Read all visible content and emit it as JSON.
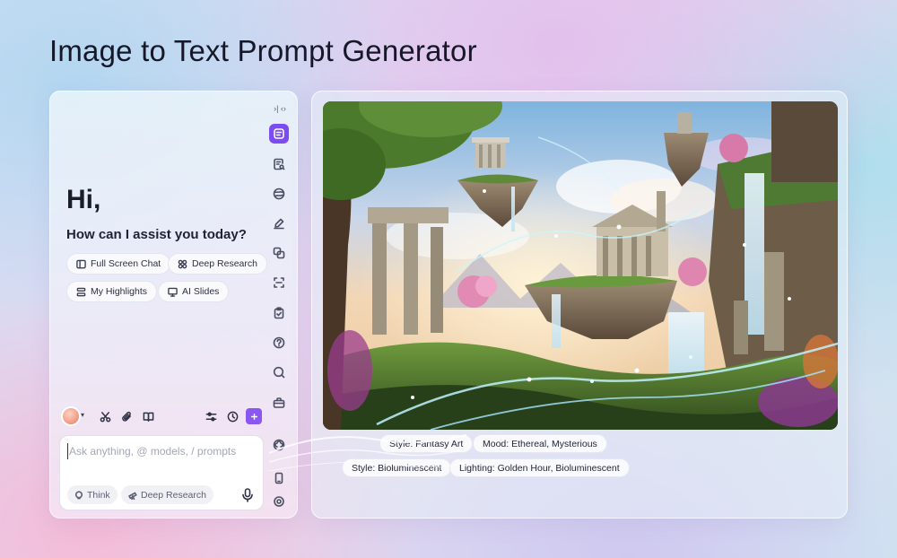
{
  "page": {
    "title": "Image to Text Prompt Generator"
  },
  "sidebar_rail": {
    "toggle_glyphs": "›| ‹›",
    "icons": [
      "chat-icon",
      "document-search-icon",
      "globe-icon",
      "pen-icon",
      "translate-icon",
      "scan-icon",
      "clipboard-check-icon",
      "help-icon",
      "search-chat-icon",
      "toolbox-icon",
      "ai-brain-icon",
      "mobile-icon",
      "settings-icon"
    ]
  },
  "greeting": {
    "hi": "Hi,",
    "subtitle": "How can I assist you today?"
  },
  "quick_actions": [
    {
      "label": "Full Screen Chat",
      "icon": "sidebar-layout-icon"
    },
    {
      "label": "Deep Research",
      "icon": "grid-icon"
    },
    {
      "label": "My Highlights",
      "icon": "highlights-icon"
    },
    {
      "label": "AI Slides",
      "icon": "slides-icon"
    }
  ],
  "toolbar": {
    "icons": [
      "model-avatar",
      "scissors-icon",
      "attach-icon",
      "book-icon",
      "sliders-icon",
      "history-icon",
      "new-chat-icon"
    ]
  },
  "composer": {
    "placeholder": "Ask anything, @ models, / prompts",
    "value": "",
    "think_label": "Think",
    "deep_research_label": "Deep Research"
  },
  "result_tags": [
    "Style: Fantasy Art",
    "Mood: Ethereal, Mysterious",
    "Style: Bioluminescent",
    "Lighting: Golden Hour, Bioluminescent"
  ],
  "colors": {
    "accent": "#7b4cf2",
    "chip_bg": "#ffffff",
    "title": "#16182a"
  }
}
